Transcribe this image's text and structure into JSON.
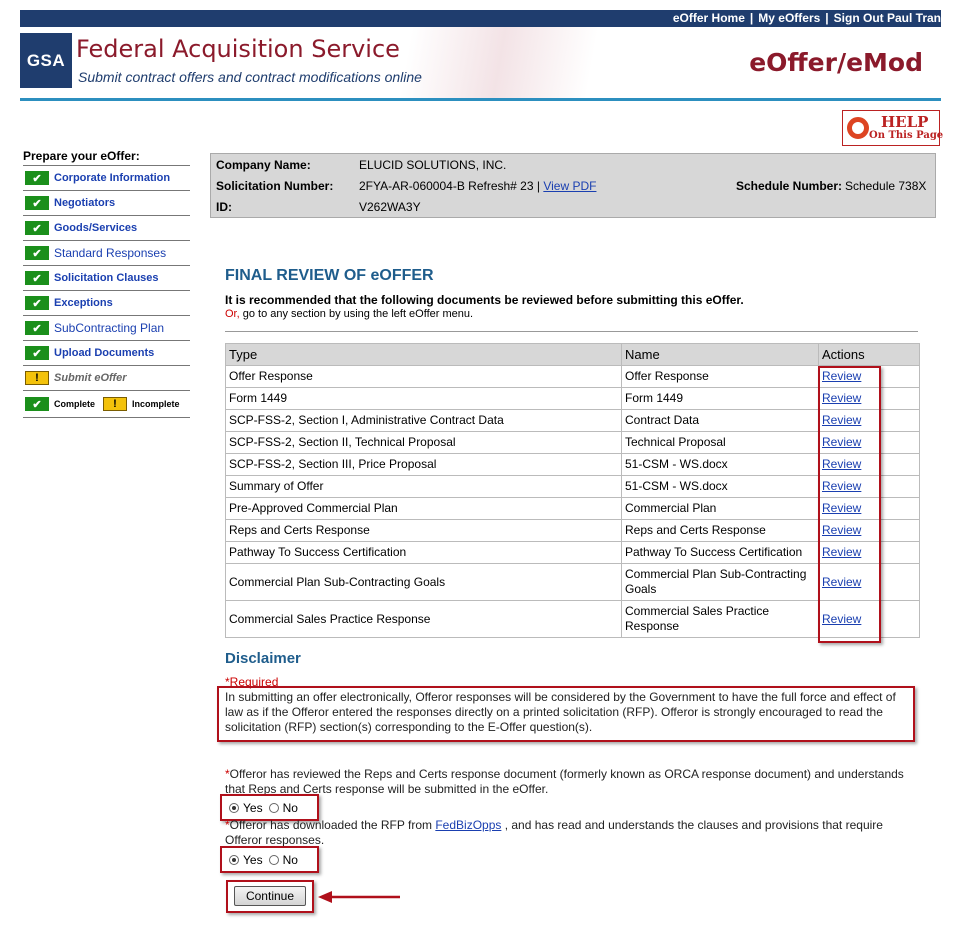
{
  "top_nav": {
    "home": "eOffer Home",
    "my_eoffers": "My eOffers",
    "signout": "Sign Out Paul Tran",
    "separator": "|"
  },
  "header": {
    "logo_text": "GSA",
    "org_title": "Federal Acquisition Service",
    "org_subtitle": "Submit contract offers and contract modifications online",
    "app_title": "eOffer/eMod"
  },
  "help": {
    "top": "HELP",
    "bottom": "On This Page"
  },
  "menu": {
    "title": "Prepare your eOffer:",
    "items": [
      {
        "label": "Corporate Information",
        "status": "complete"
      },
      {
        "label": "Negotiators",
        "status": "complete"
      },
      {
        "label": "Goods/Services",
        "status": "complete"
      },
      {
        "label": "Standard Responses",
        "status": "complete"
      },
      {
        "label": "Solicitation Clauses",
        "status": "complete"
      },
      {
        "label": "Exceptions",
        "status": "complete"
      },
      {
        "label": "SubContracting Plan",
        "status": "complete"
      },
      {
        "label": "Upload Documents",
        "status": "complete"
      },
      {
        "label": "Submit eOffer",
        "status": "incomplete"
      }
    ],
    "legend_complete": "Complete",
    "legend_incomplete": "Incomplete"
  },
  "company": {
    "name_label": "Company Name:",
    "name_value": "ELUCID SOLUTIONS, INC.",
    "solicitation_label": "Solicitation Number:",
    "solicitation_value": "2FYA-AR-060004-B Refresh# 23 |",
    "view_pdf": "View PDF",
    "schedule_label": "Schedule Number:",
    "schedule_value": "Schedule 738X",
    "id_label": "ID:",
    "id_value": "V262WA3Y"
  },
  "review": {
    "title": "FINAL REVIEW OF eOFFER",
    "recommend": "It is recommended that the following documents be reviewed before submitting this eOffer.",
    "or_word": "Or,",
    "or_rest": " go to any section by using the left eOffer menu.",
    "columns": [
      "Type",
      "Name",
      "Actions"
    ],
    "rows": [
      {
        "type": "Offer Response",
        "name": "Offer Response",
        "action": "Review"
      },
      {
        "type": "Form 1449",
        "name": "Form 1449",
        "action": "Review"
      },
      {
        "type": "SCP-FSS-2, Section I, Administrative Contract Data",
        "name": "Contract Data",
        "action": "Review"
      },
      {
        "type": "SCP-FSS-2, Section II, Technical Proposal",
        "name": "Technical Proposal",
        "action": "Review"
      },
      {
        "type": "SCP-FSS-2, Section III, Price Proposal",
        "name": "51-CSM - WS.docx",
        "action": "Review"
      },
      {
        "type": "Summary of Offer",
        "name": "51-CSM - WS.docx",
        "action": "Review"
      },
      {
        "type": "Pre-Approved Commercial Plan",
        "name": "Commercial Plan",
        "action": "Review"
      },
      {
        "type": "Reps and Certs Response",
        "name": "Reps and Certs Response",
        "action": "Review"
      },
      {
        "type": "Pathway To Success Certification",
        "name": "Pathway To Success Certification",
        "action": "Review"
      },
      {
        "type": "Commercial Plan Sub-Contracting Goals",
        "name": "Commercial Plan Sub-Contracting Goals",
        "action": "Review"
      },
      {
        "type": "Commercial Sales Practice Response",
        "name": "Commercial Sales Practice Response",
        "action": "Review"
      }
    ]
  },
  "disclaimer": {
    "title": "Disclaimer",
    "required": "*Required",
    "text": "In submitting an offer electronically, Offeror responses will be considered by the Government to have the full force and effect of law as if the Offeror entered the responses directly on a printed solicitation (RFP). Offeror is strongly encouraged to read the solicitation (RFP) section(s) corresponding to the E-Offer question(s)."
  },
  "questions": {
    "q1_star": "*",
    "q1_text": "Offeror has reviewed the Reps and Certs response document (formerly known as ORCA response document) and understands that Reps and Certs response will be submitted in the eOffer.",
    "q1_yes": "Yes",
    "q1_no": "No",
    "q1_selected": "Yes",
    "q2_star": "*",
    "q2_before": "Offeror has downloaded the RFP from ",
    "q2_link": "FedBizOpps",
    "q2_after": " , and has read and understands the clauses and provisions that require Offeror responses.",
    "q2_yes": "Yes",
    "q2_no": "No",
    "q2_selected": "Yes"
  },
  "continue_label": "Continue",
  "colors": {
    "navy": "#1f3d6e",
    "brand_red": "#8b1a2b",
    "annotation_red": "#b0101b",
    "link": "#1a3fb0",
    "heading_blue": "#1f5d8c"
  }
}
